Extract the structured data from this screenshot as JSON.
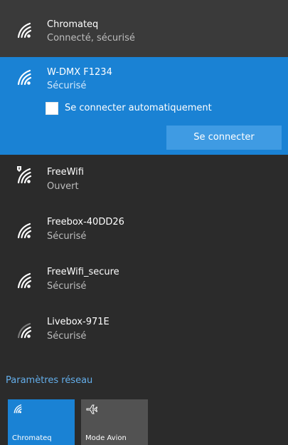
{
  "networks": [
    {
      "name": "Chromateq",
      "status": "Connecté, sécurisé",
      "icon": "wifi-icon"
    },
    {
      "name": "W-DMX F1234",
      "status": "Sécurisé",
      "icon": "wifi-icon"
    },
    {
      "name": "FreeWifi",
      "status": "Ouvert",
      "icon": "wifi-open-shield-icon"
    },
    {
      "name": "Freebox-40DD26",
      "status": "Sécurisé",
      "icon": "wifi-icon"
    },
    {
      "name": "FreeWifi_secure",
      "status": "Sécurisé",
      "icon": "wifi-icon"
    },
    {
      "name": "Livebox-971E",
      "status": "Sécurisé",
      "icon": "wifi-weak-icon"
    }
  ],
  "selected": {
    "auto_connect_label": "Se connecter automatiquement",
    "auto_connect_checked": false,
    "connect_button": "Se connecter"
  },
  "settings_link": "Paramètres réseau",
  "tiles": [
    {
      "label": "Chromateq",
      "icon": "wifi-icon",
      "active": true
    },
    {
      "label": "Mode Avion",
      "icon": "airplane-icon",
      "active": false
    }
  ],
  "colors": {
    "accent": "#1a82d4",
    "panel_bg": "#2b2b2b",
    "connected_bg": "#3a3a3a",
    "button_bg": "#3f9be3",
    "link": "#64aeea"
  }
}
